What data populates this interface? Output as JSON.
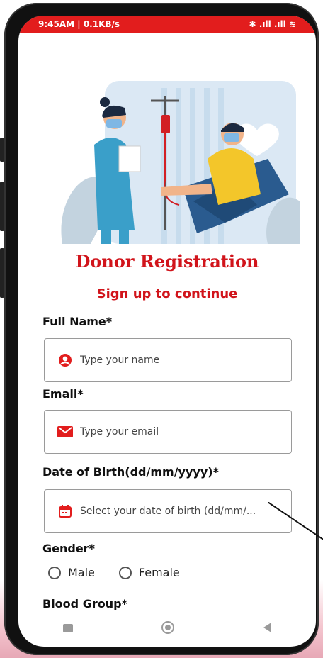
{
  "status_bar": {
    "left_text": "9:45AM | 0.1KB/s",
    "right_text": "✱ .ıll .ıll ≋"
  },
  "form": {
    "title": "Donor Registration",
    "subtitle": "Sign up to continue",
    "fields": [
      {
        "label": "Full Name*",
        "placeholder": "Type your name",
        "icon": "user-icon"
      },
      {
        "label": "Email*",
        "placeholder": "Type your email",
        "icon": "mail-icon"
      },
      {
        "label": "Date of Birth(dd/mm/yyyy)*",
        "placeholder": "Select your date of birth (dd/mm/...",
        "icon": "calendar-icon"
      }
    ],
    "gender": {
      "label": "Gender*",
      "options": [
        "Male",
        "Female"
      ]
    },
    "blood_group": {
      "label": "Blood Group*"
    }
  },
  "colors": {
    "accent": "#d1141b",
    "status_bar": "#e21d1d"
  },
  "nav": {
    "icons": [
      "square-icon",
      "circle-icon",
      "back-triangle-icon"
    ]
  }
}
